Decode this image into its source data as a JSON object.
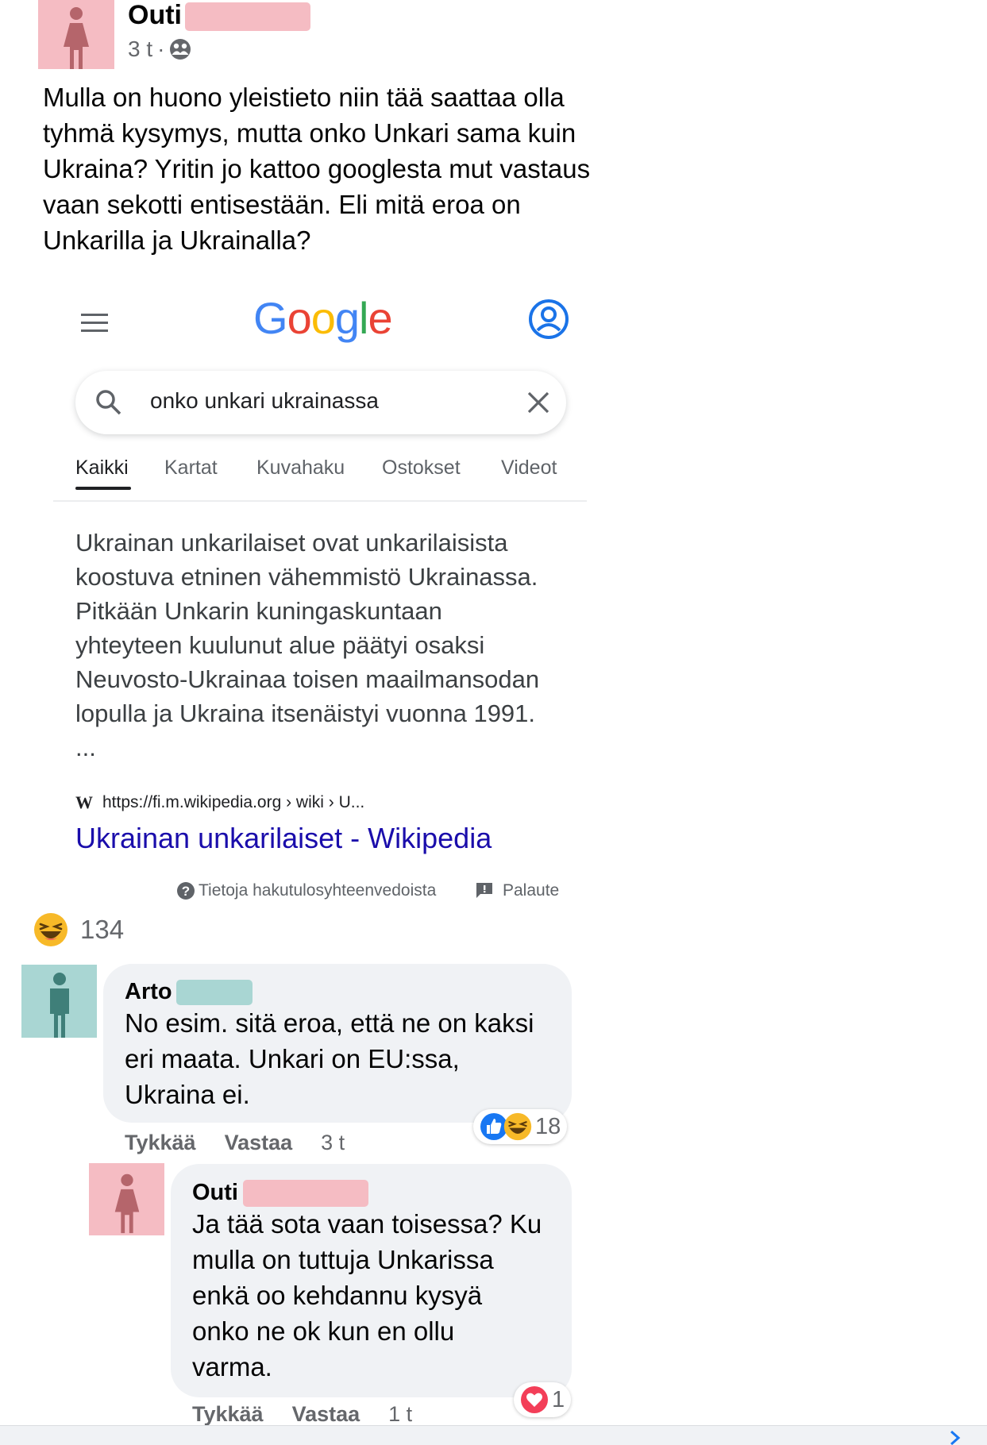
{
  "post": {
    "author_first": "Outi",
    "time": "3 t",
    "separator": "·",
    "text_lines": [
      "Mulla on huono yleistieto niin tää saattaa olla",
      "tyhmä kysymys, mutta onko Unkari sama kuin",
      "Ukraina? Yritin jo kattoo googlesta mut vastaus",
      "vaan sekotti entisestään. Eli mitä eroa on",
      "Unkarilla ja Ukrainalla?"
    ],
    "reaction_count": "134"
  },
  "google": {
    "logo_letters": [
      "G",
      "o",
      "o",
      "g",
      "l",
      "e"
    ],
    "logo_colors": [
      "#4285F4",
      "#EA4335",
      "#FBBC05",
      "#4285F4",
      "#34A853",
      "#EA4335"
    ],
    "search_query": "onko unkari ukrainassa",
    "tabs": [
      "Kaikki",
      "Kartat",
      "Kuvahaku",
      "Ostokset",
      "Videot"
    ],
    "active_tab": "Kaikki",
    "snippet_lines": [
      "Ukrainan unkarilaiset ovat unkarilaisista",
      "koostuva etninen vähemmistö Ukrainassa.",
      "Pitkään Unkarin kuningaskuntaan",
      "yhteyteen kuulunut alue päätyi osaksi",
      "Neuvosto-Ukrainaa toisen maailmansodan",
      "lopulla ja Ukraina itsenäistyi vuonna 1991.",
      "..."
    ],
    "source_logo": "W",
    "source_url": "https://fi.m.wikipedia.org › wiki › U...",
    "result_title": "Ukrainan unkarilaiset - Wikipedia",
    "about_link": "Tietoja hakutulosyhteenvedoista",
    "feedback_link": "Palaute"
  },
  "comments": [
    {
      "author_first": "Arto",
      "text_lines": [
        "No esim. sitä eroa, että ne on kaksi",
        "eri maata. Unkari on EU:ssa,",
        "Ukraina ei."
      ],
      "like_label": "Tykkää",
      "reply_label": "Vastaa",
      "time": "3 t",
      "reaction_count": "18"
    },
    {
      "author_first": "Outi",
      "text_lines": [
        "Ja tää sota vaan toisessa? Ku",
        "mulla on tuttuja Unkarissa",
        "enkä oo kehdannu kysyä",
        "onko ne ok kun en ollu",
        "varma."
      ],
      "like_label": "Tykkää",
      "reply_label": "Vastaa",
      "time": "1 t",
      "reaction_count": "1"
    }
  ],
  "colors": {
    "pink_avatar": "#f5bcc3",
    "pink_figure": "#b5656b",
    "teal_avatar": "#a9d6d3",
    "teal_figure": "#3f7f79",
    "link_blue": "#1a0dab",
    "fb_blue": "#1877f2"
  }
}
